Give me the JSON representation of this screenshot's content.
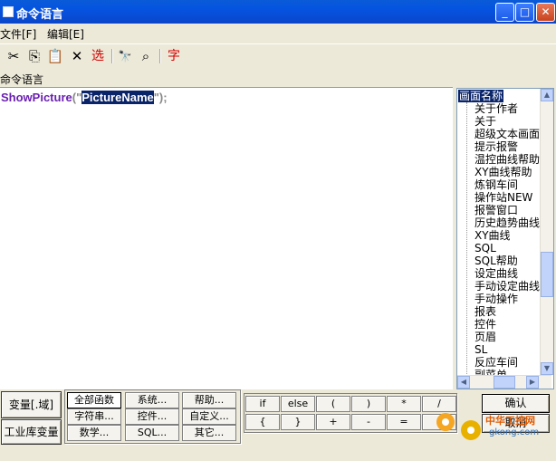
{
  "window": {
    "title": "命令语言"
  },
  "menu": [
    "文件[F]",
    "编辑[E]"
  ],
  "toolbar": {
    "cut_glyph": "✂",
    "copy_glyph": "⎘",
    "paste_glyph": "📋",
    "delete_glyph": "✕",
    "select_label": "选",
    "find_glyph": "🔭",
    "replace_glyph": "⌕",
    "font_label": "字"
  },
  "caption": "命令语言",
  "code": {
    "function": "ShowPicture",
    "open": "(\"",
    "argument": "PictureName",
    "close": "\");"
  },
  "picture_list": {
    "header": "画面名称",
    "items": [
      "关于作者",
      "关于",
      "超级文本画面",
      "提示报警",
      "温控曲线帮助",
      "XY曲线帮助",
      "炼钢车间",
      "操作站NEW",
      "报警窗口",
      "历史趋势曲线",
      "XY曲线",
      "SQL",
      "SQL帮助",
      "设定曲线",
      "手动设定曲线",
      "手动操作",
      "报表",
      "控件",
      "页眉",
      "SL",
      "反应车间",
      "副菜单"
    ]
  },
  "left_buttons": {
    "variable": "变量[.域]",
    "db_variable": "工业库变量"
  },
  "function_buttons": [
    [
      "全部函数",
      "系统...",
      "帮助..."
    ],
    [
      "字符串...",
      "控件...",
      "自定义..."
    ],
    [
      "数学...",
      "SQL...",
      "其它..."
    ]
  ],
  "operator_buttons": [
    [
      "if",
      "else",
      "(",
      ")",
      "*",
      "/"
    ],
    [
      "{",
      "}",
      "+",
      "-",
      "=",
      ";"
    ]
  ],
  "actions": {
    "ok": "确认",
    "cancel": "取消"
  },
  "watermark": {
    "text": "中华工控网",
    "url": "gkong.com"
  },
  "colors": {
    "titlebar": "#0553e1",
    "function_name": "#6a1fb2",
    "selection": "#0a246a",
    "toolbar_red": "#d40000"
  }
}
